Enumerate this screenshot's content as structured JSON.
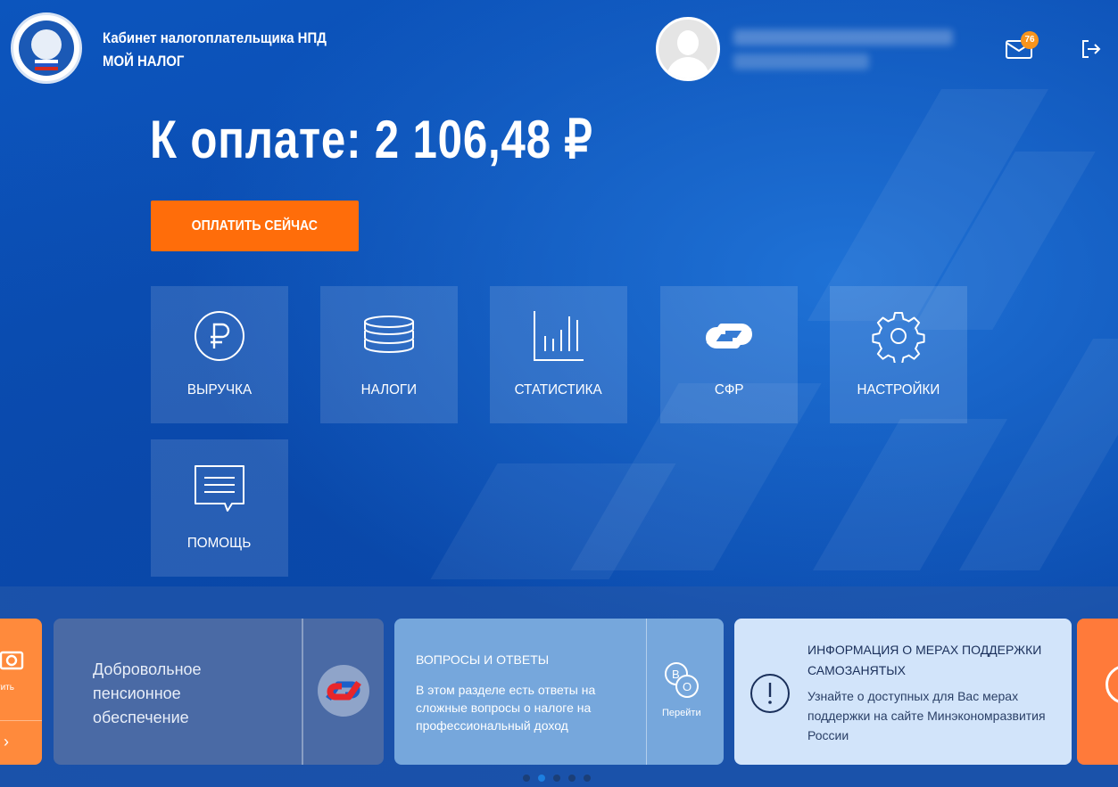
{
  "header": {
    "app_title_line1": "Кабинет налогоплательщика НПД",
    "app_title_line2": "МОЙ НАЛОГ",
    "mail_badge": "76"
  },
  "summary": {
    "amount_text": "К оплате: 2 106,48 ₽",
    "pay_button": "ОПЛАТИТЬ СЕЙЧАС"
  },
  "tiles": [
    {
      "label": "ВЫРУЧКА",
      "icon": "ruble-icon"
    },
    {
      "label": "НАЛОГИ",
      "icon": "coins-stack-icon"
    },
    {
      "label": "СТАТИСТИКА",
      "icon": "bar-chart-icon"
    },
    {
      "label": "СФР",
      "icon": "sfr-logo-icon"
    },
    {
      "label": "НАСТРОЙКИ",
      "icon": "gear-icon"
    },
    {
      "label": "ПОМОЩЬ",
      "icon": "chat-icon"
    }
  ],
  "cards": {
    "left_partial_label": "тить",
    "pension_text": "Добровольное пенсионное обеспечение",
    "faq_title": "ВОПРОСЫ И ОТВЕТЫ",
    "faq_desc": "В этом разделе есть ответы на сложные вопросы о налоге на профессиональный доход",
    "faq_go": "Перейти",
    "support_title": "ИНФОРМАЦИЯ О МЕРАХ ПОДДЕРЖКИ САМОЗАНЯТЫХ",
    "support_desc": "Узнайте о доступных для Вас мерах поддержки на сайте Минэкономразвития России"
  },
  "carousel": {
    "dots": 5,
    "active_index": 1
  },
  "colors": {
    "background": "#0a4fb3",
    "accent_orange": "#ff6d0a",
    "badge": "#f7941d",
    "sfr_red": "#e8262b",
    "sfr_blue": "#1b5fc9"
  }
}
